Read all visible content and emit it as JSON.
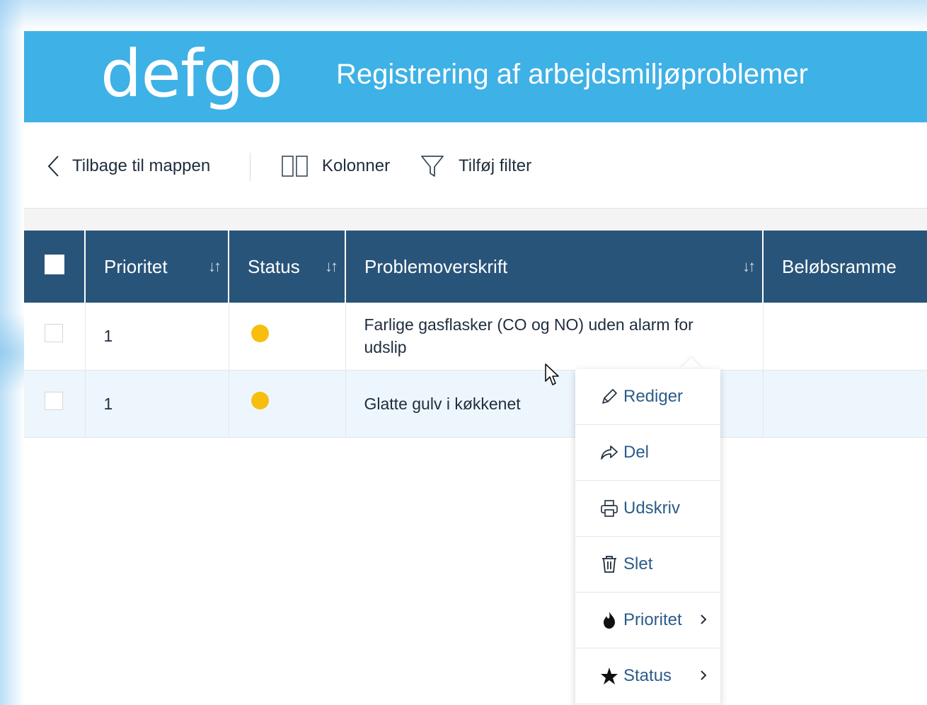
{
  "header": {
    "logo": "defgo",
    "title": "Registrering af arbejdsmiljøproblemer"
  },
  "toolbar": {
    "back_label": "Tilbage til mappen",
    "columns_label": "Kolonner",
    "filter_label": "Tilføj filter"
  },
  "table": {
    "columns": [
      "Prioritet",
      "Status",
      "Problemoverskrift",
      "Beløbsramme"
    ],
    "rows": [
      {
        "priority": "1",
        "status_color": "#f7be0e",
        "title": "Farlige gasflasker (CO og NO) uden alarm for udslip"
      },
      {
        "priority": "1",
        "status_color": "#f7be0e",
        "title": "Glatte gulv i køkkenet"
      }
    ]
  },
  "context_menu": {
    "items": [
      {
        "label": "Rediger",
        "icon": "pencil-icon"
      },
      {
        "label": "Del",
        "icon": "share-icon"
      },
      {
        "label": "Udskriv",
        "icon": "printer-icon"
      },
      {
        "label": "Slet",
        "icon": "trash-icon"
      },
      {
        "label": "Prioritet",
        "icon": "flame-icon",
        "submenu": true
      },
      {
        "label": "Status",
        "icon": "star-icon",
        "submenu": true
      }
    ]
  },
  "colors": {
    "header_bg": "#3eb1e6",
    "table_header_bg": "#29547a",
    "menu_text": "#2b5c8a",
    "status_yellow": "#f7be0e"
  }
}
